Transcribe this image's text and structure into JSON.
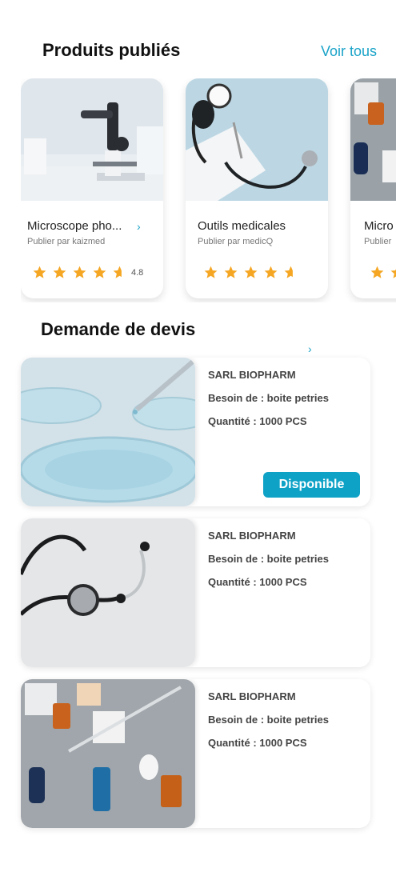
{
  "published": {
    "title": "Produits publiés",
    "see_all": "Voir tous",
    "cards": [
      {
        "name": "Microscope pho...",
        "by": "Publier par kaizmed",
        "rating": "4.8"
      },
      {
        "name": "Outils medicales",
        "by": "Publier par medicQ",
        "rating": ""
      },
      {
        "name": "Micro",
        "by": "Publier",
        "rating": ""
      }
    ]
  },
  "quotes": {
    "title": "Demande de devis",
    "items": [
      {
        "company": "SARL BIOPHARM",
        "need": "Besoin de : boite petries",
        "qty": "Quantité : 1000 PCS",
        "badge": "Disponible"
      },
      {
        "company": "SARL BIOPHARM",
        "need": "Besoin de : boite petries",
        "qty": "Quantité : 1000 PCS"
      },
      {
        "company": "SARL BIOPHARM",
        "need": "Besoin de : boite petries",
        "qty": "Quantité : 1000 PCS"
      }
    ]
  },
  "colors": {
    "accent": "#1aa3c8",
    "badge": "#0fa2c7",
    "star": "#f5a623"
  },
  "icons": [
    "chevron-right-icon",
    "star-icon",
    "half-star-icon"
  ]
}
